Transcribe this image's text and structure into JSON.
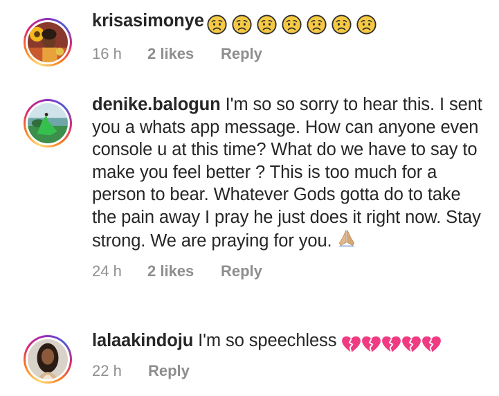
{
  "comments": [
    {
      "username": "krisasimonye",
      "text": "",
      "emoji": "worried-face-icon",
      "emoji_count": 7,
      "time": "16 h",
      "likes": "2 likes",
      "reply_label": "Reply",
      "avatar": "woman-with-sunflower-avatar"
    },
    {
      "username": "denike.balogun",
      "text": " I'm so so sorry to hear this. I sent you a whats app message. How can anyone even console u at this time? What do we have to say to make you feel better ? This is too much for a person to bear. Whatever Gods gotta do to take the pain away I pray he just does it right now. Stay strong. We are praying for you. ",
      "emoji": "folded-hands-icon",
      "emoji_count": 1,
      "time": "24 h",
      "likes": "2 likes",
      "reply_label": "Reply",
      "avatar": "green-dress-landscape-avatar"
    },
    {
      "username": "lalaakindoju",
      "text": " I'm so speechless ",
      "emoji": "broken-heart-icon",
      "emoji_count": 5,
      "time": "22 h",
      "likes": "",
      "reply_label": "Reply",
      "avatar": "woman-portrait-avatar"
    }
  ],
  "colors": {
    "text": "#262626",
    "meta": "#8e8e8e",
    "broken_heart": "#f03a82",
    "worried_face": "#f5c542"
  }
}
